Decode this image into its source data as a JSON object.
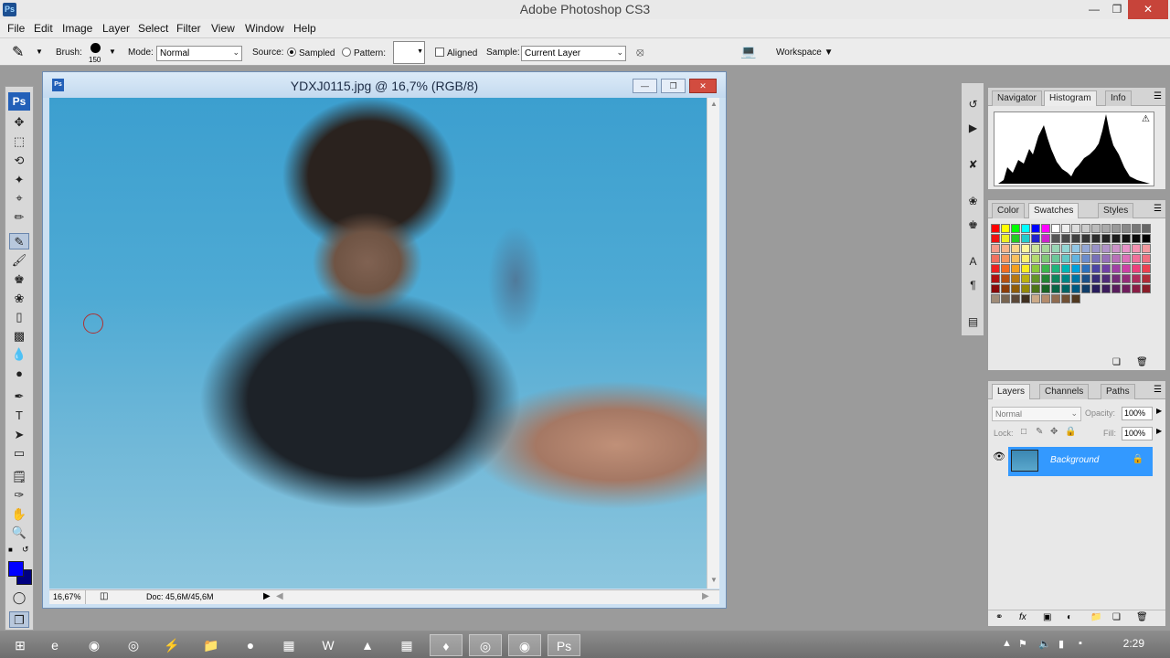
{
  "app": {
    "title": "Adobe Photoshop CS3",
    "logo": "Ps"
  },
  "menu": [
    "File",
    "Edit",
    "Image",
    "Layer",
    "Select",
    "Filter",
    "View",
    "Window",
    "Help"
  ],
  "options": {
    "brush_label": "Brush:",
    "brush_size": "150",
    "mode_label": "Mode:",
    "mode_value": "Normal",
    "source_label": "Source:",
    "sampled_label": "Sampled",
    "pattern_label": "Pattern:",
    "aligned_label": "Aligned",
    "sample_label": "Sample:",
    "sample_value": "Current Layer",
    "workspace_label": "Workspace"
  },
  "document": {
    "title": "YDXJ0115.jpg @ 16,7% (RGB/8)",
    "zoom": "16,67%",
    "doc_size": "Doc: 45,6M/45,6M"
  },
  "panels": {
    "top_tabs": [
      "Navigator",
      "Histogram",
      "Info"
    ],
    "mid_tabs": [
      "Color",
      "Swatches",
      "Styles"
    ],
    "bottom_tabs": [
      "Layers",
      "Channels",
      "Paths"
    ],
    "layers_mode": "Normal",
    "opacity_label": "Opacity:",
    "opacity_value": "100%",
    "lock_label": "Lock:",
    "fill_label": "Fill:",
    "fill_value": "100%",
    "layer_name": "Background"
  },
  "colors": {
    "foreground": "#0000ff",
    "background": "#000080",
    "accent": "#3399ff"
  },
  "taskbar": {
    "clock": "2:29"
  }
}
